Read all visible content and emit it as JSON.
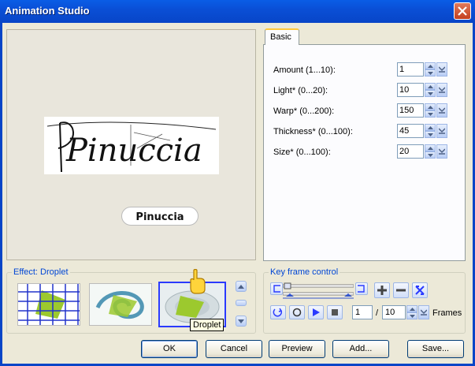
{
  "window": {
    "title": "Animation Studio",
    "close_icon": "close-icon"
  },
  "preview": {
    "signature_text": "Pinuccia",
    "watermark_text": "Pinuccia"
  },
  "tabs": [
    {
      "label": "Basic",
      "active": true
    }
  ],
  "params": [
    {
      "label": "Amount (1...10):",
      "value": "1"
    },
    {
      "label": "Light* (0...20):",
      "value": "10"
    },
    {
      "label": "Warp* (0...200):",
      "value": "150"
    },
    {
      "label": "Thickness* (0...100):",
      "value": "45"
    },
    {
      "label": "Size* (0...100):",
      "value": "20"
    }
  ],
  "effect": {
    "legend": "Effect: Droplet",
    "tooltip": "Droplet"
  },
  "keyframe": {
    "legend": "Key frame control",
    "current_frame": "1",
    "separator": "/",
    "total_frames": "10",
    "frames_label": "Frames"
  },
  "buttons": {
    "ok": "OK",
    "cancel": "Cancel",
    "preview": "Preview",
    "add": "Add...",
    "save": "Save..."
  },
  "colors": {
    "titlebar": "#0a4fd6",
    "accent_link": "#0046d5",
    "tab_highlight": "#ffc83c"
  }
}
